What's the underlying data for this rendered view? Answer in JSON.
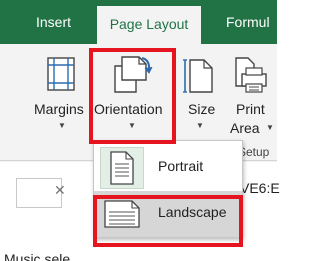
{
  "ribbon": {
    "tabs": [
      {
        "label": "Insert"
      },
      {
        "label": "Page Layout",
        "active": true
      },
      {
        "label": "Formul"
      }
    ],
    "buttons": [
      {
        "label": "Margins",
        "icon": "margins-icon"
      },
      {
        "label": "Orientation",
        "icon": "orientation-icon"
      },
      {
        "label": "Size",
        "icon": "size-icon"
      },
      {
        "label": "Print",
        "label2": "Area",
        "icon": "print-area-icon"
      }
    ],
    "group_label": "Setup",
    "accent_color": "#217346"
  },
  "formula_bar": {
    "cancel_glyph": "✕",
    "name_box": "VE6:E"
  },
  "orientation_menu": {
    "items": [
      {
        "label": "Portrait",
        "icon": "portrait-page-icon"
      },
      {
        "label": "Landscape",
        "icon": "landscape-page-icon",
        "highlighted": true
      }
    ]
  },
  "sheet": {
    "cell_text": "Music sele"
  },
  "annotation": {
    "highlight_color": "#e5141f"
  }
}
